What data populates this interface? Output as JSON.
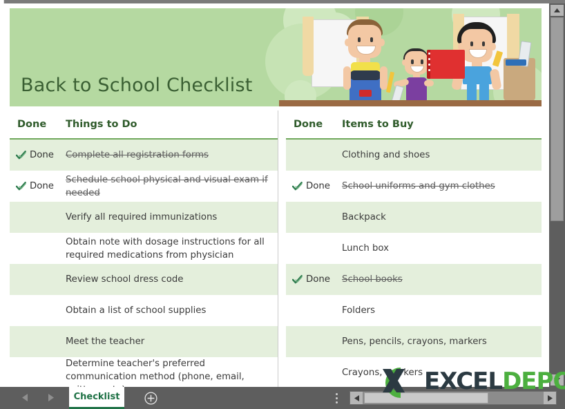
{
  "app": {
    "banner_title": "Back to School Checklist",
    "watermark": {
      "part1": "EXCEL",
      "part2": "DEPO",
      "mark_icon": "x-logo-icon"
    }
  },
  "tables": {
    "left": {
      "headers": {
        "done": "Done",
        "task": "Things to Do"
      },
      "rows": [
        {
          "done": "Done",
          "checked": true,
          "task": "Complete all registration forms"
        },
        {
          "done": "Done",
          "checked": true,
          "task": "Schedule school physical and visual exam if needed"
        },
        {
          "done": "",
          "checked": false,
          "task": "Verify all required immunizations"
        },
        {
          "done": "",
          "checked": false,
          "task": "Obtain note with dosage instructions for all required medications from physician"
        },
        {
          "done": "",
          "checked": false,
          "task": "Review school dress code"
        },
        {
          "done": "",
          "checked": false,
          "task": "Obtain a list of school supplies"
        },
        {
          "done": "",
          "checked": false,
          "task": "Meet the teacher"
        },
        {
          "done": "",
          "checked": false,
          "task": "Determine teacher's preferred communication method (phone, email, written note)"
        }
      ]
    },
    "right": {
      "headers": {
        "done": "Done",
        "task": "Items to Buy"
      },
      "rows": [
        {
          "done": "",
          "checked": false,
          "task": "Clothing and shoes"
        },
        {
          "done": "Done",
          "checked": true,
          "task": "School uniforms and gym clothes"
        },
        {
          "done": "",
          "checked": false,
          "task": "Backpack"
        },
        {
          "done": "",
          "checked": false,
          "task": "Lunch box"
        },
        {
          "done": "Done",
          "checked": true,
          "task": "School books"
        },
        {
          "done": "",
          "checked": false,
          "task": "Folders"
        },
        {
          "done": "",
          "checked": false,
          "task": "Pens, pencils, crayons, markers"
        },
        {
          "done": "",
          "checked": false,
          "task": "Crayons, markers"
        }
      ]
    }
  },
  "statusbar": {
    "prev_sheet_icon": "chevron-left-icon",
    "next_sheet_icon": "chevron-right-icon",
    "sheet_tab": "Checklist",
    "add_sheet_icon": "plus-circle-icon",
    "menu_icon": "kebab-menu-icon",
    "hscroll_left_icon": "chevron-left-icon",
    "hscroll_right_icon": "chevron-right-icon"
  },
  "vscroll": {
    "up_icon": "chevron-up-icon",
    "down_icon": "chevron-down-icon"
  },
  "colors": {
    "banner_green": "#b5d9a1",
    "title_green": "#3a5f33",
    "header_green": "#2f5b2b",
    "row_alt": "#e4efdc",
    "rule_green": "#6fa85c",
    "tab_green": "#1e7145",
    "logo_green": "#4caf3f"
  }
}
